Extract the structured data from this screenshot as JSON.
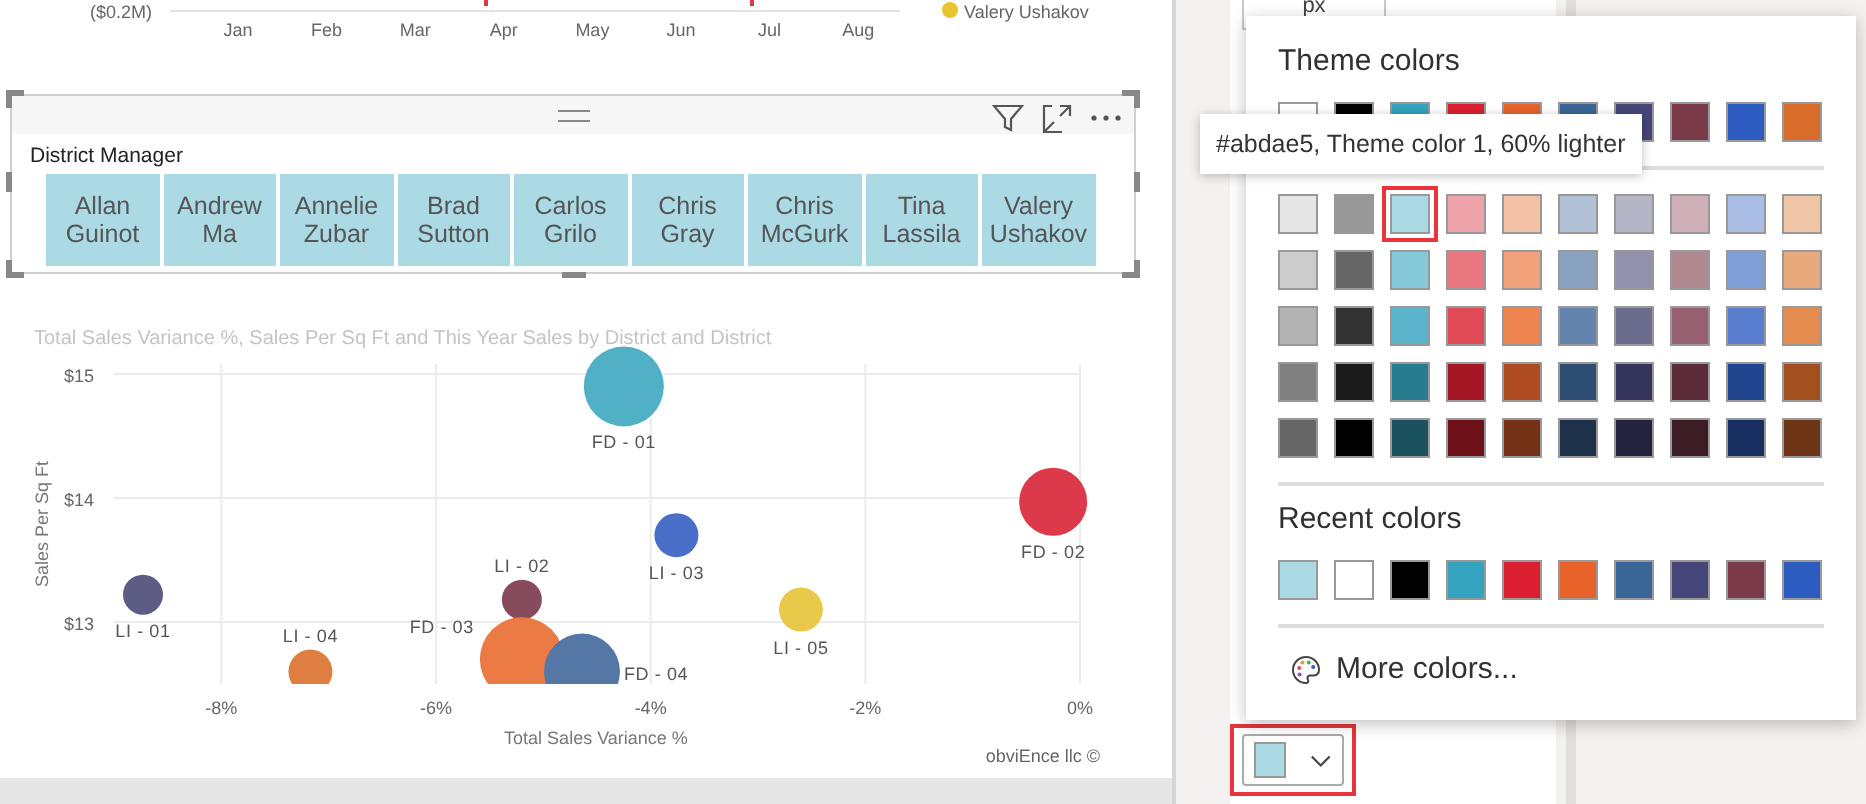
{
  "top_chart": {
    "y_tick_label": "($0.2M)",
    "months": [
      "Jan",
      "Feb",
      "Mar",
      "Apr",
      "May",
      "Jun",
      "Jul",
      "Aug"
    ],
    "legend": {
      "label": "Valery Ushakov",
      "color": "#e8c52f"
    }
  },
  "slicer": {
    "title": "District Manager",
    "items": [
      "Allan Guinot",
      "Andrew Ma",
      "Annelie Zubar",
      "Brad Sutton",
      "Carlos Grilo",
      "Chris Gray",
      "Chris McGurk",
      "Tina Lassila",
      "Valery Ushakov"
    ]
  },
  "scatter": {
    "chart_data": {
      "type": "scatter",
      "title": "Total Sales Variance %, Sales Per Sq Ft and This Year Sales by District and District",
      "xlabel": "Total Sales Variance %",
      "ylabel": "Sales Per Sq Ft",
      "xlim": [
        -9,
        0
      ],
      "ylim": [
        12.5,
        15
      ],
      "xticks": [
        {
          "value": -8,
          "label": "-8%"
        },
        {
          "value": -6,
          "label": "-6%"
        },
        {
          "value": -4,
          "label": "-4%"
        },
        {
          "value": -2,
          "label": "-2%"
        },
        {
          "value": 0,
          "label": "0%"
        }
      ],
      "yticks": [
        {
          "value": 13,
          "label": "$13"
        },
        {
          "value": 14,
          "label": "$14"
        },
        {
          "value": 15,
          "label": "$15"
        }
      ],
      "grid": true,
      "x": [
        -4.25,
        -0.25,
        -3.76,
        -8.73,
        -5.2,
        -5.2,
        -2.6,
        -7.17,
        -4.64
      ],
      "series": [
        {
          "name": "FD - 01",
          "color": "#4fb0c6",
          "values": [
            14.9,
            null,
            null,
            null,
            null,
            null,
            null,
            null,
            null
          ]
        },
        {
          "name": "FD - 02",
          "color": "#dc3a4b",
          "values": [
            null,
            13.97,
            null,
            null,
            null,
            null,
            null,
            null,
            null
          ]
        },
        {
          "name": "LI - 03",
          "color": "#4a6fc9",
          "values": [
            null,
            null,
            13.7,
            null,
            null,
            null,
            null,
            null,
            null
          ]
        },
        {
          "name": "LI - 01",
          "color": "#5c5c85",
          "values": [
            null,
            null,
            null,
            13.22,
            null,
            null,
            null,
            null,
            null
          ]
        },
        {
          "name": "LI - 02",
          "color": "#874b5b",
          "values": [
            null,
            null,
            null,
            null,
            13.18,
            null,
            null,
            null,
            null
          ]
        },
        {
          "name": "FD - 03",
          "color": "#ec7a45",
          "values": [
            null,
            null,
            null,
            null,
            null,
            12.7,
            null,
            null,
            null
          ]
        },
        {
          "name": "LI - 05",
          "color": "#e8c94a",
          "values": [
            null,
            null,
            null,
            null,
            null,
            null,
            13.1,
            null,
            null
          ]
        },
        {
          "name": "LI - 04",
          "color": "#de7e41",
          "values": [
            null,
            null,
            null,
            null,
            null,
            null,
            null,
            12.6,
            null
          ]
        },
        {
          "name": "FD - 04",
          "color": "#5577a6",
          "values": [
            null,
            null,
            null,
            null,
            null,
            null,
            null,
            null,
            12.6
          ]
        }
      ]
    },
    "credit": "obviEnce llc ©"
  },
  "format_pane": {
    "unit_field": {
      "value": "px"
    },
    "color_button": {
      "color": "#abdae5"
    }
  },
  "color_picker": {
    "theme_title": "Theme colors",
    "theme_top_row": [
      {
        "color": "#ffffff",
        "selected": false
      },
      {
        "color": "#000000",
        "selected": false
      },
      {
        "color": "#33a3bf",
        "selected": false
      },
      {
        "color": "#dc1f30",
        "selected": false
      },
      {
        "color": "#e8622a",
        "selected": false
      },
      {
        "color": "#3a6597",
        "selected": false
      },
      {
        "color": "#46467a",
        "selected": false
      },
      {
        "color": "#7a3a4a",
        "selected": false
      },
      {
        "color": "#2c5cbf",
        "selected": false
      },
      {
        "color": "#d96c2a",
        "selected": false
      }
    ],
    "theme_shades": [
      [
        {
          "color": "#e6e6e6",
          "selected": false
        },
        {
          "color": "#999999",
          "selected": false
        },
        {
          "color": "#abdae5",
          "selected": true
        },
        {
          "color": "#eda3a9",
          "selected": false
        },
        {
          "color": "#f4c1a5",
          "selected": false
        },
        {
          "color": "#b0c1d6",
          "selected": false
        },
        {
          "color": "#b5b5c8",
          "selected": false
        },
        {
          "color": "#cfb0b8",
          "selected": false
        },
        {
          "color": "#aabde5",
          "selected": false
        },
        {
          "color": "#eec6a5",
          "selected": false
        }
      ],
      [
        {
          "color": "#cccccc",
          "selected": false
        },
        {
          "color": "#666666",
          "selected": false
        },
        {
          "color": "#85c8d9",
          "selected": false
        },
        {
          "color": "#e8777f",
          "selected": false
        },
        {
          "color": "#f2a27a",
          "selected": false
        },
        {
          "color": "#8aa2c1",
          "selected": false
        },
        {
          "color": "#9191ac",
          "selected": false
        },
        {
          "color": "#b08890",
          "selected": false
        },
        {
          "color": "#809ed8",
          "selected": false
        },
        {
          "color": "#e8a97c",
          "selected": false
        }
      ],
      [
        {
          "color": "#b3b3b3",
          "selected": false
        },
        {
          "color": "#333333",
          "selected": false
        },
        {
          "color": "#5ab5cc",
          "selected": false
        },
        {
          "color": "#e04a56",
          "selected": false
        },
        {
          "color": "#ee844f",
          "selected": false
        },
        {
          "color": "#6284ad",
          "selected": false
        },
        {
          "color": "#6c6c8f",
          "selected": false
        },
        {
          "color": "#976070",
          "selected": false
        },
        {
          "color": "#5a7ecf",
          "selected": false
        },
        {
          "color": "#e48c50",
          "selected": false
        }
      ],
      [
        {
          "color": "#808080",
          "selected": false
        },
        {
          "color": "#1a1a1a",
          "selected": false
        },
        {
          "color": "#267b8f",
          "selected": false
        },
        {
          "color": "#a51724",
          "selected": false
        },
        {
          "color": "#ad4a20",
          "selected": false
        },
        {
          "color": "#2c4c71",
          "selected": false
        },
        {
          "color": "#34345c",
          "selected": false
        },
        {
          "color": "#5b2c38",
          "selected": false
        },
        {
          "color": "#21458f",
          "selected": false
        },
        {
          "color": "#a3501f",
          "selected": false
        }
      ],
      [
        {
          "color": "#666666",
          "selected": false
        },
        {
          "color": "#000000",
          "selected": false
        },
        {
          "color": "#1a5260",
          "selected": false
        },
        {
          "color": "#6e1018",
          "selected": false
        },
        {
          "color": "#743115",
          "selected": false
        },
        {
          "color": "#1e334b",
          "selected": false
        },
        {
          "color": "#23233d",
          "selected": false
        },
        {
          "color": "#3d1d25",
          "selected": false
        },
        {
          "color": "#162e60",
          "selected": false
        },
        {
          "color": "#6d3515",
          "selected": false
        }
      ]
    ],
    "tooltip": "#abdae5, Theme color 1, 60% lighter",
    "recent_title": "Recent colors",
    "recent": [
      {
        "color": "#abdae5",
        "selected": false
      },
      {
        "color": "#ffffff",
        "selected": false
      },
      {
        "color": "#000000",
        "selected": false
      },
      {
        "color": "#33a3bf",
        "selected": false
      },
      {
        "color": "#dc1f30",
        "selected": false
      },
      {
        "color": "#e8622a",
        "selected": false
      },
      {
        "color": "#3a6597",
        "selected": false
      },
      {
        "color": "#46467a",
        "selected": false
      },
      {
        "color": "#7a3a4a",
        "selected": false
      },
      {
        "color": "#2c5cbf",
        "selected": false
      }
    ],
    "more_colors": "More colors..."
  }
}
